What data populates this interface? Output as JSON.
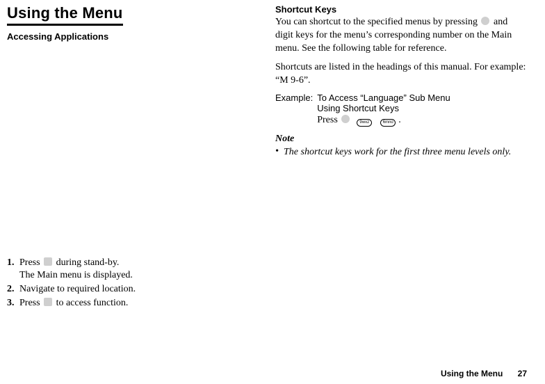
{
  "title": "Using the Menu",
  "subtitle": "Accessing Applications",
  "steps": [
    {
      "n": "1.",
      "prefix": "Press ",
      "suffix": " during stand-by.",
      "sub": "The Main menu is displayed."
    },
    {
      "n": "2.",
      "text": "Navigate to required location."
    },
    {
      "n": "3.",
      "prefix": "Press ",
      "suffix": " to access function."
    }
  ],
  "right": {
    "heading": "Shortcut Keys",
    "para1a": "You can shortcut to the specified menus by pressing ",
    "para1b": " and digit keys for the menu’s corresponding number on the Main menu. See the following table for reference.",
    "para2": "Shortcuts are listed in the headings of this manual. For example: “M 9-6”.",
    "example_label": "Example:",
    "example_line1": "To Access “Language” Sub Menu",
    "example_line2": "Using Shortcut Keys",
    "example_press_prefix": "Press ",
    "example_press_suffix": ".",
    "key1": "9wxz",
    "key2": "6mno",
    "note_heading": "Note",
    "note_bullet": "•",
    "note_text": "The shortcut keys work for the first three menu levels only."
  },
  "footer": {
    "section": "Using the Menu",
    "page": "27"
  }
}
